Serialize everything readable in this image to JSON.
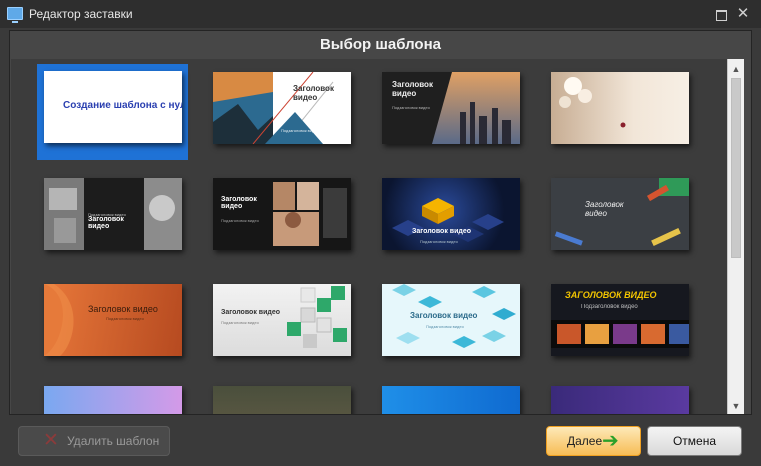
{
  "window": {
    "title": "Редактор заставки",
    "restore_icon": "restore-icon",
    "close_icon": "close-icon",
    "close_glyph": "✕"
  },
  "panel": {
    "title": "Выбор шаблона"
  },
  "templates": {
    "t1": {
      "title": "Создание шаблона с нуля",
      "selected": true
    },
    "t2": {
      "title": "Заголовок видео",
      "subtitle": "Подзаголовок видео"
    },
    "t3": {
      "title": "Заголовок видео",
      "subtitle": "Подзаголовок видео"
    },
    "t5": {
      "title": "Заголовок видео",
      "subtitle": "Подзаголовок видео"
    },
    "t6": {
      "title": "Заголовок видео",
      "subtitle": "Подзаголовок видео"
    },
    "t7": {
      "title": "Заголовок видео",
      "subtitle": "Подзаголовок видео"
    },
    "t8": {
      "title": "Заголовок видео"
    },
    "t9": {
      "title": "Заголовок видео",
      "subtitle": "Подзаголовок видео"
    },
    "t10": {
      "title": "Заголовок видео",
      "subtitle": "Подзаголовок видео"
    },
    "t11": {
      "title": "Заголовок видео",
      "subtitle": "Подзаголовок видео"
    },
    "t12": {
      "title": "ЗАГОЛОВОК ВИДЕО",
      "subtitle": "Подзаголовок видео"
    }
  },
  "scrollbar": {
    "up_glyph": "▲",
    "down_glyph": "▼"
  },
  "buttons": {
    "delete_label": "Удалить шаблон",
    "delete_glyph": "✕",
    "next_label": "Далее",
    "next_glyph": "➔",
    "cancel_label": "Отмена"
  },
  "colors": {
    "selection": "#1f72d6",
    "next_button": "#f7bd56",
    "accent_red": "#8b3b3b"
  }
}
